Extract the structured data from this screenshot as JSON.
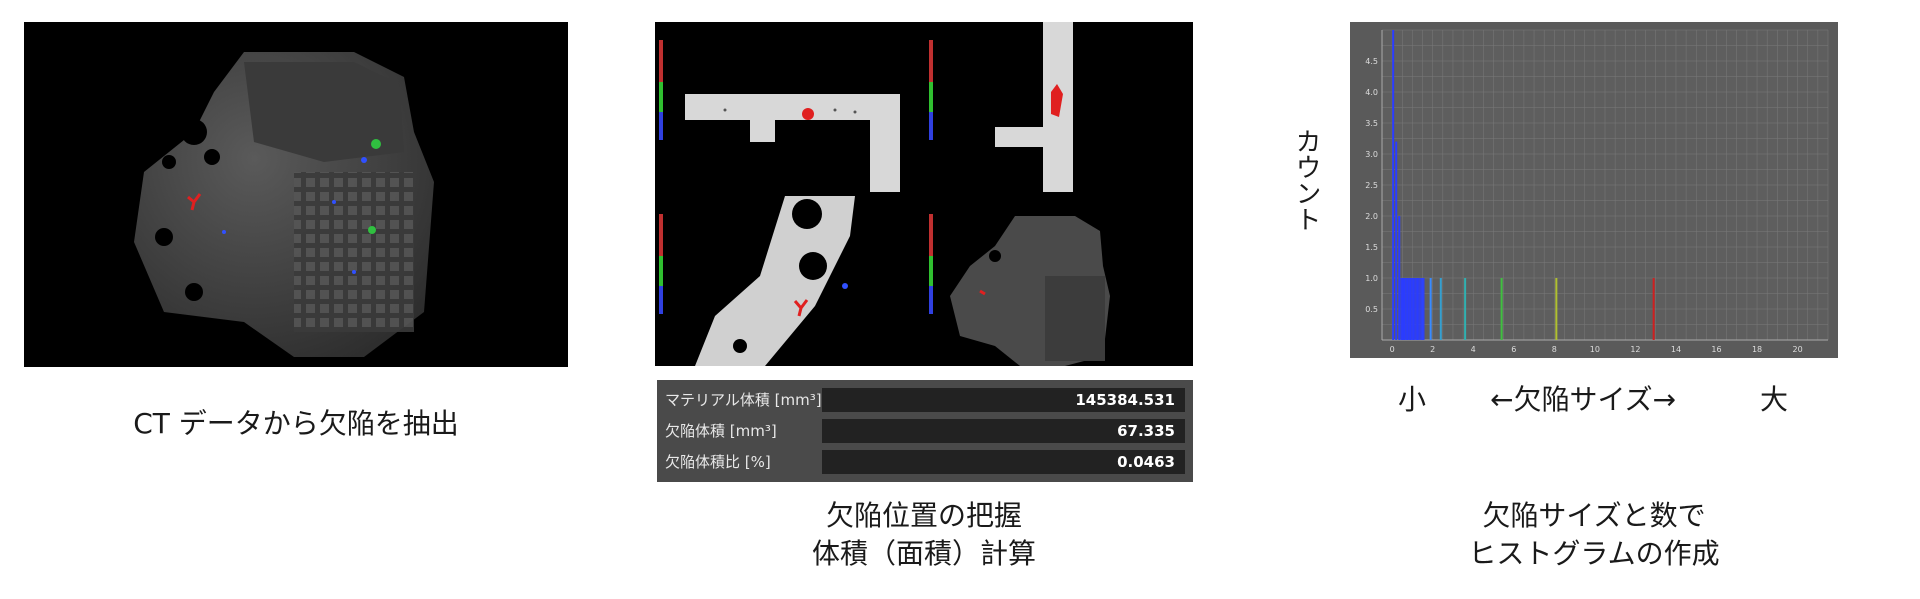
{
  "panel1": {
    "caption": "CT データから欠陥を抽出"
  },
  "panel2": {
    "caption_line1": "欠陥位置の把握",
    "caption_line2": "体積（面積）計算",
    "stats": [
      {
        "label": "マテリアル体積 [mm³]",
        "value": "145384.531"
      },
      {
        "label": "欠陥体積 [mm³]",
        "value": "67.335"
      },
      {
        "label": "欠陥体積比 [%]",
        "value": "0.0463"
      }
    ]
  },
  "panel3": {
    "caption_line1": "欠陥サイズと数で",
    "caption_line2": "ヒストグラムの作成",
    "y_label": "カウント",
    "x_small": "小",
    "x_mid": "←欠陥サイズ→",
    "x_large": "大"
  },
  "chart_data": {
    "type": "bar",
    "xlabel": "←欠陥サイズ→",
    "ylabel": "カウント",
    "x_ticks": [
      0,
      2,
      4,
      6,
      8,
      10,
      12,
      14,
      16,
      18,
      20
    ],
    "y_ticks": [
      0.5,
      1.0,
      1.5,
      2.0,
      2.5,
      3.0,
      3.5,
      4.0,
      4.5
    ],
    "xlim": [
      -0.5,
      21.5
    ],
    "ylim": [
      0,
      5
    ],
    "grid": true,
    "bars": [
      {
        "x": 0.05,
        "y": 5.0,
        "color": "#2a3cff"
      },
      {
        "x": 0.2,
        "y": 3.2,
        "color": "#2a3cff"
      },
      {
        "x": 0.35,
        "y": 2.0,
        "color": "#2a3cff"
      },
      {
        "x": 0.5,
        "y": 1.0,
        "color": "#2a3cff"
      },
      {
        "x": 0.6,
        "y": 1.0,
        "color": "#2a3cff"
      },
      {
        "x": 0.75,
        "y": 1.0,
        "color": "#2a3cff"
      },
      {
        "x": 0.9,
        "y": 1.0,
        "color": "#2a3cff"
      },
      {
        "x": 1.05,
        "y": 1.0,
        "color": "#2a3cff"
      },
      {
        "x": 1.25,
        "y": 1.0,
        "color": "#2a3cff"
      },
      {
        "x": 1.5,
        "y": 1.0,
        "color": "#3a6cff"
      },
      {
        "x": 1.9,
        "y": 1.0,
        "color": "#3a8cff"
      },
      {
        "x": 2.4,
        "y": 1.0,
        "color": "#35a0d0"
      },
      {
        "x": 3.6,
        "y": 1.0,
        "color": "#30b0b0"
      },
      {
        "x": 5.4,
        "y": 1.0,
        "color": "#40c040"
      },
      {
        "x": 8.1,
        "y": 1.0,
        "color": "#b0c030"
      },
      {
        "x": 12.9,
        "y": 1.0,
        "color": "#d02020"
      }
    ]
  }
}
